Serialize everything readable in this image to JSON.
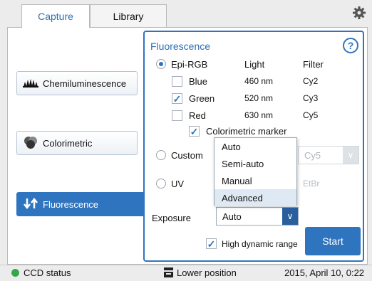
{
  "tabs": [
    {
      "label": "Capture",
      "active": true
    },
    {
      "label": "Library",
      "active": false
    }
  ],
  "settings_icon": "gear-icon",
  "modes": [
    {
      "label": "Chemiluminescence",
      "icon": "chemiluminescence-icon"
    },
    {
      "label": "Colorimetric",
      "icon": "colorimetric-icon"
    },
    {
      "label": "Fluorescence",
      "icon": "fluorescence-arrows-icon",
      "active": true
    }
  ],
  "panel": {
    "title": "Fluorescence",
    "help_label": "?",
    "columns": {
      "light": "Light",
      "filter": "Filter"
    },
    "epi_rgb": {
      "label": "Epi-RGB",
      "selected": true,
      "channels": [
        {
          "name": "Blue",
          "checked": false,
          "light": "460 nm",
          "filter": "Cy2"
        },
        {
          "name": "Green",
          "checked": true,
          "light": "520 nm",
          "filter": "Cy3"
        },
        {
          "name": "Red",
          "checked": false,
          "light": "630 nm",
          "filter": "Cy5"
        }
      ],
      "colorimetric_marker": {
        "label": "Colorimetric marker",
        "checked": true
      }
    },
    "custom": {
      "label": "Custom",
      "selected": false,
      "filter_value": "Cy5"
    },
    "uv": {
      "label": "UV",
      "selected": false,
      "filter_value": "EtBr"
    },
    "exposure": {
      "label": "Exposure",
      "value": "Auto",
      "options": [
        "Auto",
        "Semi-auto",
        "Manual",
        "Advanced"
      ],
      "highlighted": "Advanced"
    },
    "hdr": {
      "label": "High dynamic range",
      "checked": true
    },
    "start_label": "Start"
  },
  "status": {
    "ccd_label": "CCD status",
    "ccd_color": "#36a84a",
    "position_label": "Lower position",
    "datetime": "2015, April 10, 0:22"
  },
  "colors": {
    "accent": "#2f74bf"
  }
}
